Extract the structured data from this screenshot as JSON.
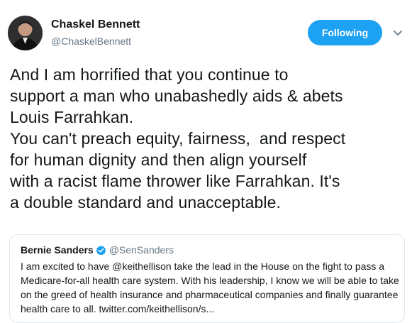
{
  "author": {
    "display_name": "Chaskel Bennett",
    "handle": "@ChaskelBennett",
    "avatar_icon": "user-avatar"
  },
  "follow_button": {
    "label": "Following",
    "color": "#1da1f2"
  },
  "menu": {
    "icon": "chevron-down-icon"
  },
  "tweet": {
    "text": "And I am horrified that you continue to\nsupport a man who unabashedly aids & abets\nLouis Farrahkan.\nYou can't preach equity, fairness,  and respect\nfor human dignity and then align yourself\nwith a racist flame thrower like Farrahkan. It's\na double standard and unacceptable."
  },
  "quoted_tweet": {
    "display_name": "Bernie Sanders",
    "verified_icon": "verified-badge-icon",
    "handle": "@SenSanders",
    "text": "I am excited to have @keithellison take the lead in the House on the fight to pass a Medicare-for-all health care system. With his leadership, I know we will be able to take on the greed of health insurance and pharmaceutical companies and finally guarantee health care to all. twitter.com/keithellison/s..."
  }
}
